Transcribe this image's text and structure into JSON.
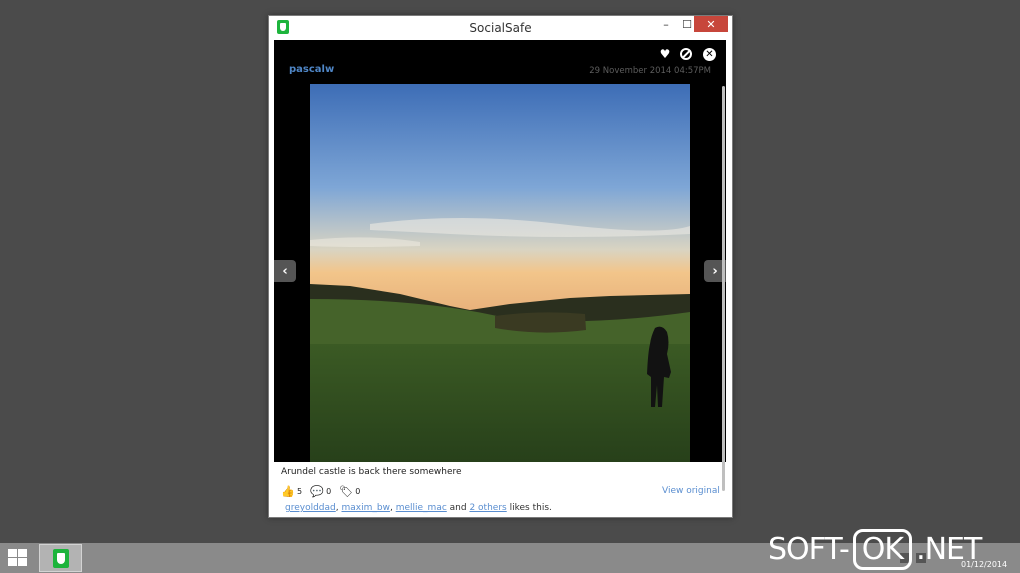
{
  "window": {
    "title": "SocialSafe",
    "minimize": "–",
    "maximize": "☐",
    "close": "✕"
  },
  "post": {
    "username": "pascalw",
    "timestamp": "29 November 2014 04:57PM",
    "caption": "Arundel castle is back there somewhere",
    "likes_count": "5",
    "comments_count": "0",
    "tags_count": "0",
    "view_original": "View original",
    "liked_by": [
      "greyolddad",
      "maxim_bw",
      "mellie_mac"
    ],
    "others": "2 others",
    "likes_suffix": "likes this.",
    "separator": ",",
    "and": "and"
  },
  "icons": {
    "heart": "heart-icon",
    "block": "block-icon",
    "close": "close-circle-icon",
    "prev": "chevron-left-icon",
    "next": "chevron-right-icon",
    "thumbs": "thumbs-up-icon",
    "comment": "comment-icon",
    "tag": "tag-icon"
  },
  "taskbar": {
    "date": "01/12/2014"
  },
  "watermark": {
    "left": "SOFT-",
    "mid": "OK",
    "right": ".NET"
  },
  "colors": {
    "desktop": "#4b4b4b",
    "link": "#5a8ed0",
    "close_button": "#c7463b",
    "app_green": "#1db43c"
  }
}
